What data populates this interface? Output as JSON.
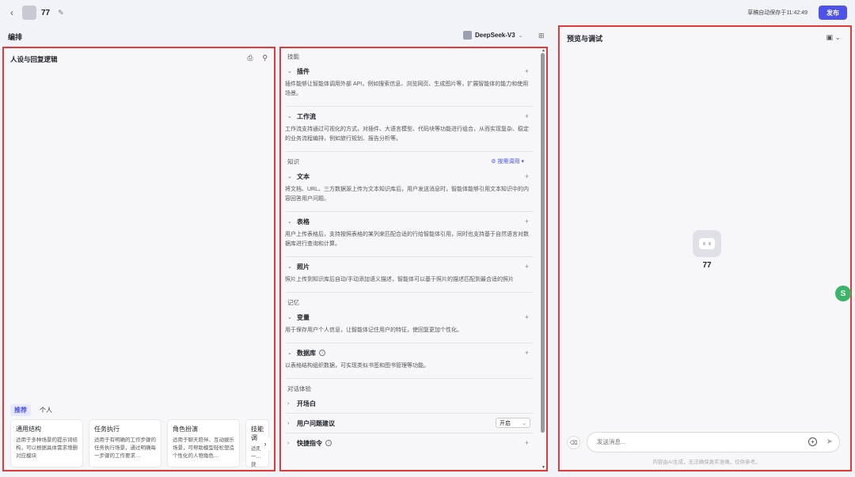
{
  "topbar": {
    "bot_name": "77",
    "autosave": "草稿自动保存于11:42:49",
    "publish_label": "发布"
  },
  "arrange": {
    "title": "编排",
    "model": "DeepSeek-V3"
  },
  "left": {
    "title": "人设与回复逻辑",
    "tabs": [
      "推荐",
      "个人"
    ],
    "cards": [
      {
        "title": "通用结构",
        "desc": "适用于多种场景的提示词结构，可以根据具体需求增删对应模块"
      },
      {
        "title": "任务执行",
        "desc": "适用于有明确的工作步骤的任务执行场景，通过明确每一步骤的工作要求…"
      },
      {
        "title": "角色扮演",
        "desc": "适用于聊天陪伴、互动娱乐场景，可帮助模型轻松塑造个性化的人物角色…"
      },
      {
        "title": "技能调",
        "desc": "适用一…获取…的场…"
      }
    ]
  },
  "middle": {
    "skills_label": "技能",
    "plugin": {
      "label": "插件",
      "desc": "插件能够让智能体调用外部 API，例如搜索信息、浏览网页、生成图片等，扩展智能体的能力和使用场景。"
    },
    "workflow": {
      "label": "工作流",
      "desc": "工作流支持通过可视化的方式，对插件、大语言模型、代码块等功能进行组合，从而实现复杂、稳定的业务流程编排，例如旅行规划、报告分析等。"
    },
    "knowledge_label": "知识",
    "recall_label": "按需调用",
    "text": {
      "label": "文本",
      "desc": "将文档、URL、三方数据源上传为文本知识库后，用户发送消息时，智能体能够引用文本知识中的内容回答用户问题。"
    },
    "table": {
      "label": "表格",
      "desc": "用户上传表格后，支持按照表格的某列来匹配合适的行给智能体引用，同时也支持基于自然语言对数据库进行查询和计算。"
    },
    "photo": {
      "label": "照片",
      "desc": "照片上传到知识库后自动/手动添加语义描述，智能体可以基于照片的描述匹配到最合适的照片"
    },
    "memory_label": "记忆",
    "variable": {
      "label": "变量",
      "desc": "用于保存用户个人信息，让智能体记住用户的特征，使回复更加个性化。"
    },
    "database": {
      "label": "数据库",
      "desc": "以表格结构组织数据，可实现类似书签和图书管理等功能。"
    },
    "dialog_label": "对话体验",
    "opening": "开场白",
    "suggest": "用户问题建议",
    "suggest_value": "开启",
    "shortcut": "快捷指令"
  },
  "right": {
    "title": "预览与调试",
    "bot_name": "77",
    "input_placeholder": "发送消息...",
    "disclaimer": "内容由AI生成，无法确保真实准确，仅供参考。"
  }
}
